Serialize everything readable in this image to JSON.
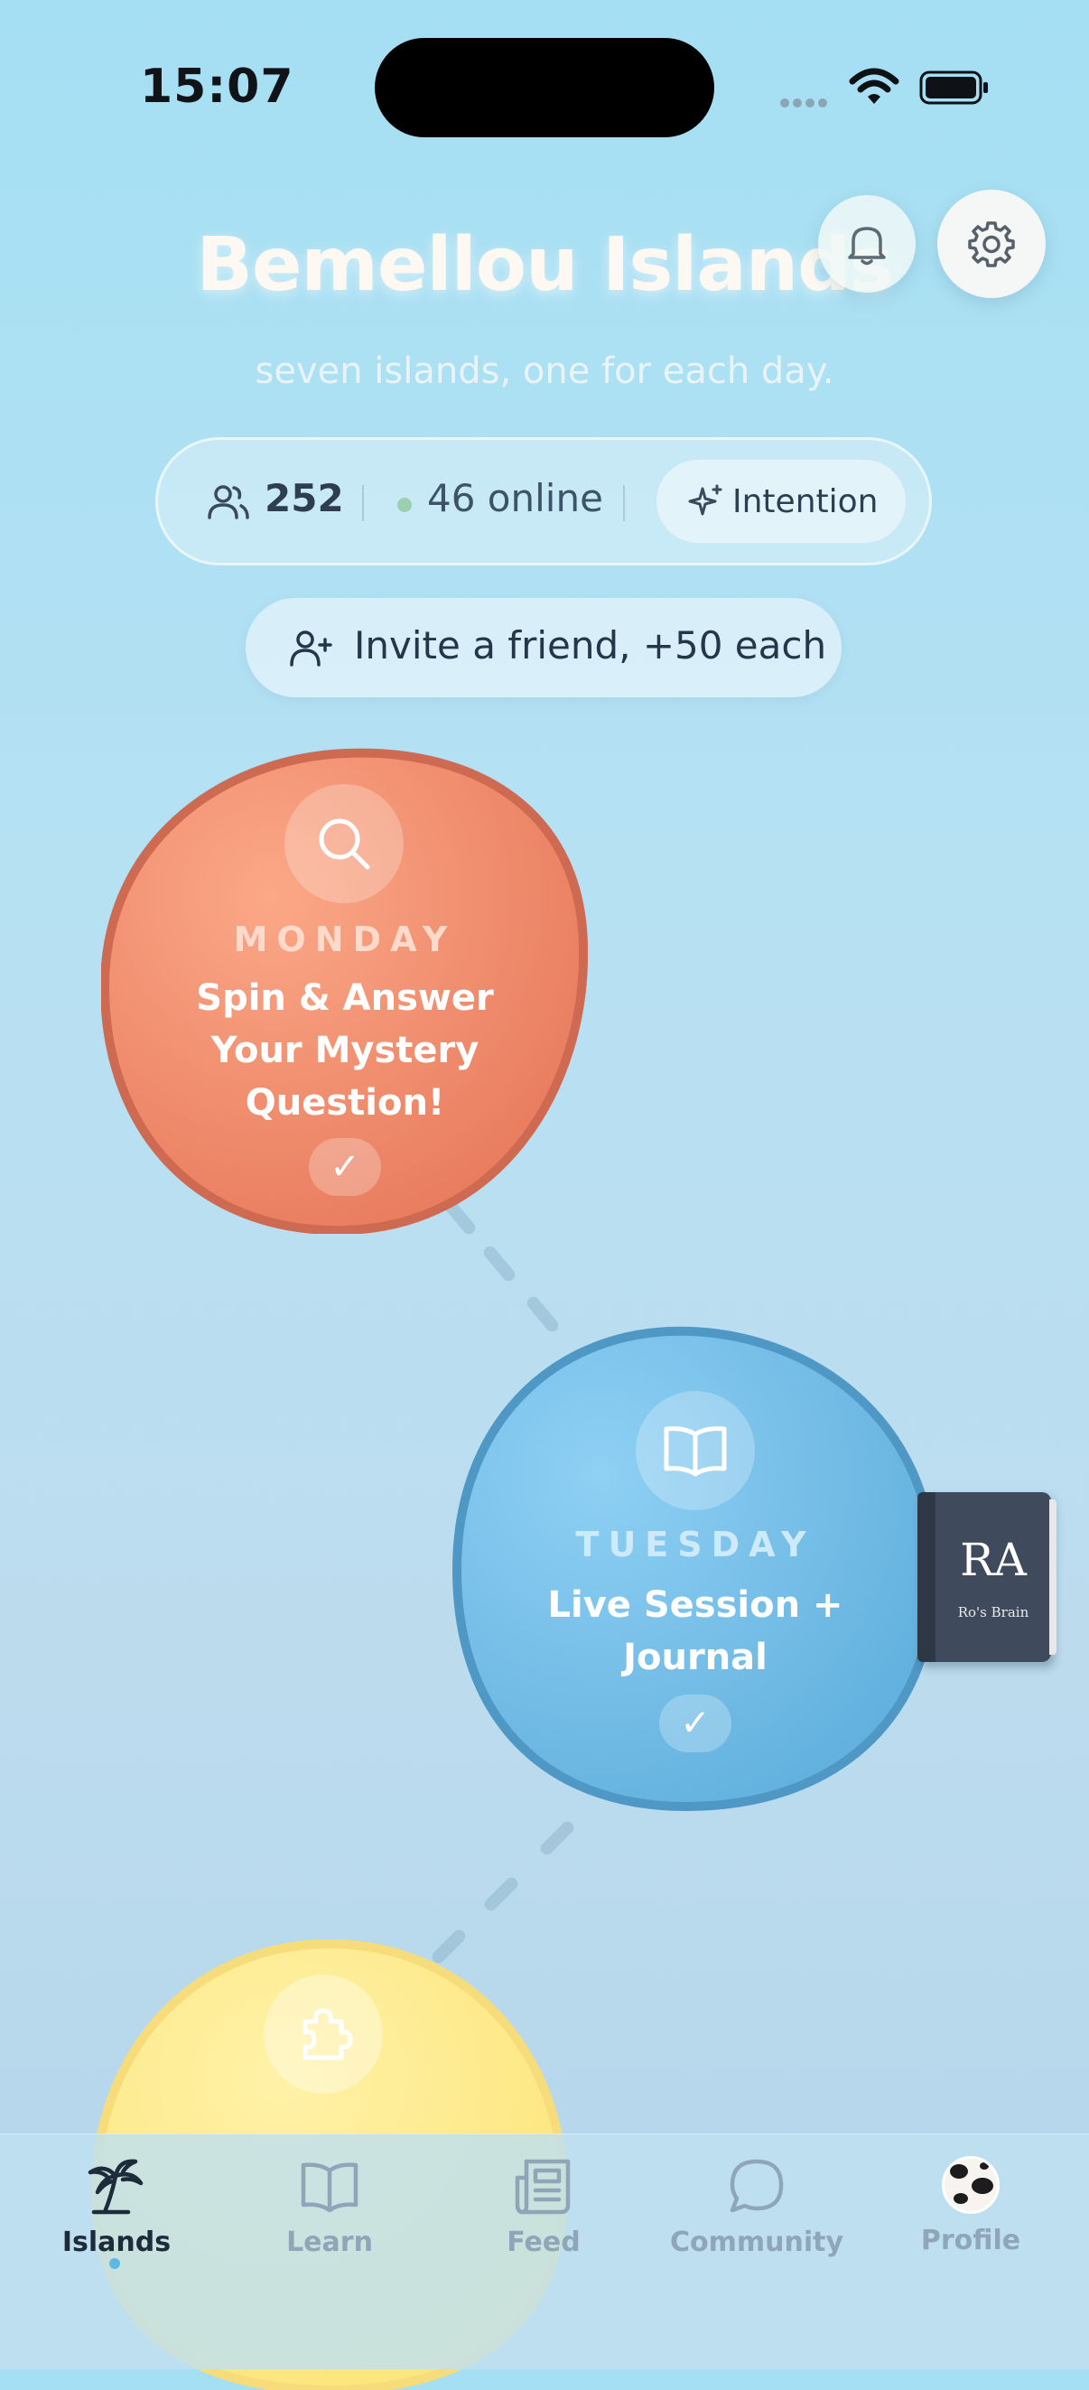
{
  "status_bar": {
    "time": "15:07"
  },
  "header": {
    "title": "Bemellou Islands",
    "subtitle": "seven islands, one for each day."
  },
  "stats": {
    "member_count": "252",
    "online": "46 online",
    "intention_label": "Intention"
  },
  "invite": {
    "label": "Invite a friend, +50 each"
  },
  "islands": [
    {
      "day": "MONDAY",
      "activity_lines": [
        "Spin & Answer",
        "Your Mystery",
        "Question!"
      ],
      "icon": "search-icon",
      "completed": true,
      "color": "#f08a66"
    },
    {
      "day": "TUESDAY",
      "activity_lines": [
        "Live Session +",
        "Journal"
      ],
      "icon": "book-open-icon",
      "completed": true,
      "color": "#78c1ec"
    },
    {
      "day": "",
      "activity_lines": [],
      "icon": "puzzle-icon",
      "completed": false,
      "color": "#fde68a"
    }
  ],
  "checkmark": "✓",
  "book": {
    "initials": "RA",
    "subtitle": "Ro's Brain"
  },
  "tabs": [
    {
      "label": "Islands",
      "icon": "palm-tree-icon",
      "active": true
    },
    {
      "label": "Learn",
      "icon": "book-open-icon",
      "active": false
    },
    {
      "label": "Feed",
      "icon": "newspaper-icon",
      "active": false
    },
    {
      "label": "Community",
      "icon": "chat-bubble-icon",
      "active": false
    },
    {
      "label": "Profile",
      "icon": "avatar",
      "active": false
    }
  ],
  "colors": {
    "background": "#b7e1f3",
    "monday": "#f08a66",
    "tuesday": "#78c1ec",
    "wednesday": "#fde68a",
    "online_dot": "#9ccfae",
    "active_tab_dot": "#5fb7e6"
  }
}
